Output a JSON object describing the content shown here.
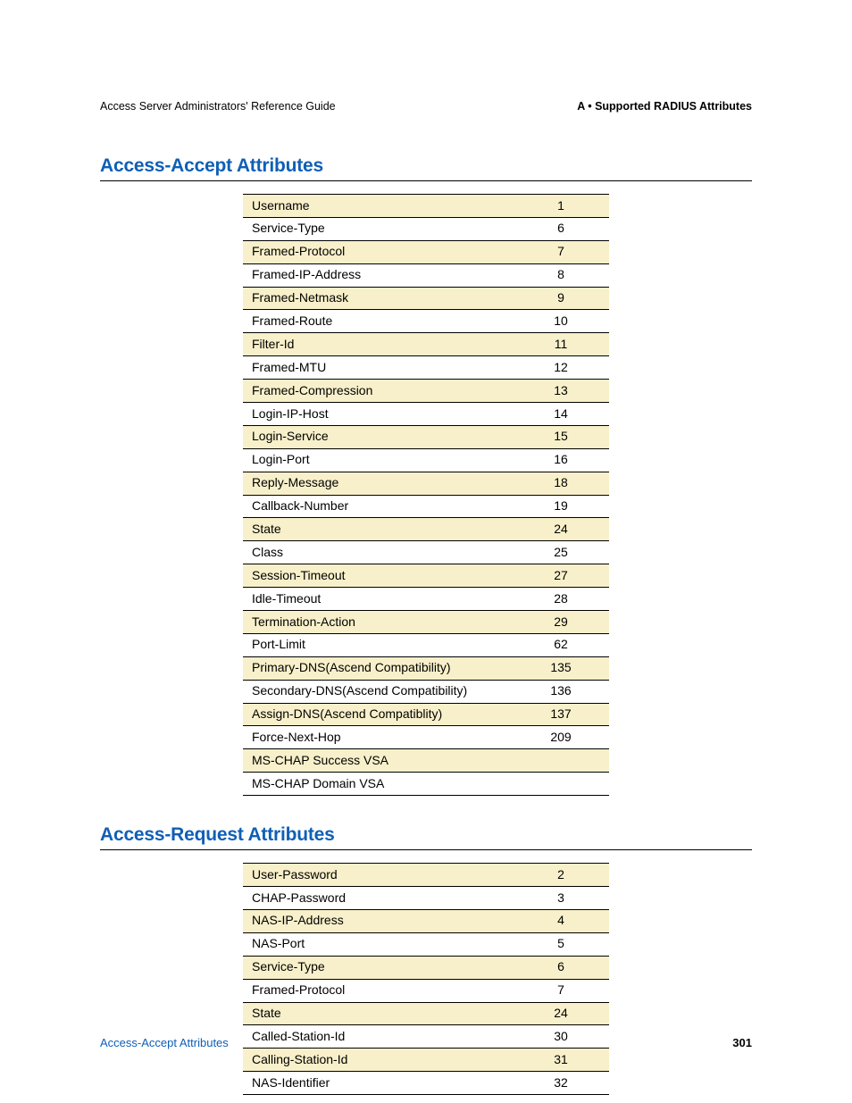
{
  "header": {
    "left": "Access Server Administrators' Reference Guide",
    "right": "A • Supported RADIUS Attributes"
  },
  "sections": {
    "accept": {
      "title": "Access-Accept Attributes",
      "rows": [
        {
          "name": "Username",
          "num": "1"
        },
        {
          "name": "Service-Type",
          "num": "6"
        },
        {
          "name": "Framed-Protocol",
          "num": "7"
        },
        {
          "name": "Framed-IP-Address",
          "num": "8"
        },
        {
          "name": "Framed-Netmask",
          "num": "9"
        },
        {
          "name": "Framed-Route",
          "num": "10"
        },
        {
          "name": "Filter-Id",
          "num": "11"
        },
        {
          "name": "Framed-MTU",
          "num": "12"
        },
        {
          "name": "Framed-Compression",
          "num": "13"
        },
        {
          "name": "Login-IP-Host",
          "num": "14"
        },
        {
          "name": "Login-Service",
          "num": "15"
        },
        {
          "name": "Login-Port",
          "num": "16"
        },
        {
          "name": "Reply-Message",
          "num": "18"
        },
        {
          "name": "Callback-Number",
          "num": "19"
        },
        {
          "name": "State",
          "num": "24"
        },
        {
          "name": "Class",
          "num": "25"
        },
        {
          "name": "Session-Timeout",
          "num": "27"
        },
        {
          "name": "Idle-Timeout",
          "num": "28"
        },
        {
          "name": "Termination-Action",
          "num": "29"
        },
        {
          "name": "Port-Limit",
          "num": "62"
        },
        {
          "name": "Primary-DNS(Ascend Compatibility)",
          "num": "135"
        },
        {
          "name": "Secondary-DNS(Ascend Compatibility)",
          "num": "136"
        },
        {
          "name": "Assign-DNS(Ascend Compatiblity)",
          "num": "137"
        },
        {
          "name": "Force-Next-Hop",
          "num": "209"
        },
        {
          "name": "MS-CHAP Success VSA",
          "num": ""
        },
        {
          "name": "MS-CHAP Domain VSA",
          "num": ""
        }
      ]
    },
    "request": {
      "title": "Access-Request Attributes",
      "rows": [
        {
          "name": "User-Password",
          "num": "2"
        },
        {
          "name": "CHAP-Password",
          "num": "3"
        },
        {
          "name": "NAS-IP-Address",
          "num": "4"
        },
        {
          "name": "NAS-Port",
          "num": "5"
        },
        {
          "name": "Service-Type",
          "num": "6"
        },
        {
          "name": "Framed-Protocol",
          "num": "7"
        },
        {
          "name": "State",
          "num": "24"
        },
        {
          "name": "Called-Station-Id",
          "num": "30"
        },
        {
          "name": "Calling-Station-Id",
          "num": "31"
        },
        {
          "name": "NAS-Identifier",
          "num": "32"
        }
      ]
    }
  },
  "footer": {
    "left": "Access-Accept Attributes",
    "right": "301"
  }
}
